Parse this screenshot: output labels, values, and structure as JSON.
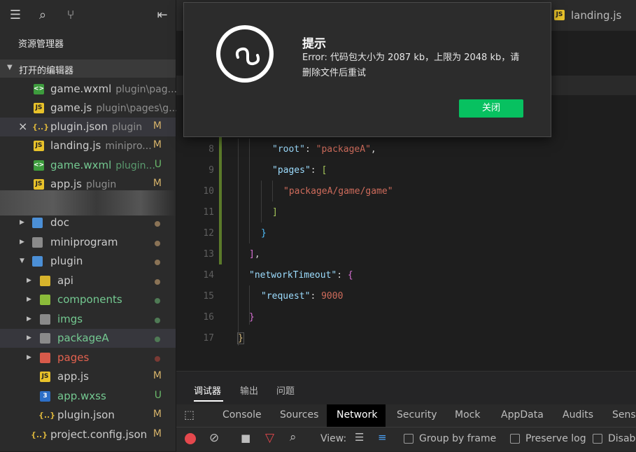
{
  "sidebar": {
    "explorer_title": "资源管理器",
    "open_editors_title": "打开的编辑器",
    "open_editors": [
      {
        "icon": "<>",
        "name": "game.wxml",
        "path": "plugin\\pag...",
        "status": ""
      },
      {
        "icon": "JS",
        "name": "game.js",
        "path": "plugin\\pages\\g...",
        "status": ""
      },
      {
        "icon": "{..}",
        "name": "plugin.json",
        "path": "plugin",
        "status": "M"
      },
      {
        "icon": "JS",
        "name": "landing.js",
        "path": "minipro...",
        "status": "M"
      },
      {
        "icon": "<>",
        "name": "game.wxml",
        "path": "plugin...",
        "status": "U"
      },
      {
        "icon": "JS",
        "name": "app.js",
        "path": "plugin",
        "status": "M"
      }
    ],
    "tree": [
      {
        "name": "doc",
        "status": ""
      },
      {
        "name": "miniprogram",
        "status": ""
      },
      {
        "name": "plugin",
        "status": ""
      },
      {
        "name": "api",
        "status": ""
      },
      {
        "name": "components",
        "status": ""
      },
      {
        "name": "imgs",
        "status": ""
      },
      {
        "name": "packageA",
        "status": ""
      },
      {
        "name": "pages",
        "status": ""
      },
      {
        "name": "app.js",
        "status": "M"
      },
      {
        "name": "app.wxss",
        "status": "U"
      },
      {
        "name": "plugin.json",
        "status": "M"
      },
      {
        "name": "project.config.json",
        "status": "M"
      }
    ]
  },
  "editor": {
    "tab_landing": "landing.js",
    "tab_landing_icon": "JS",
    "line_numbers": [
      "8",
      "9",
      "10",
      "11",
      "12",
      "13",
      "14",
      "15",
      "16",
      "17"
    ],
    "code": {
      "l8_key": "\"root\"",
      "l8_colon": ": ",
      "l8_val": "\"packageA\"",
      "l8_comma": ",",
      "l9_key": "\"pages\"",
      "l9_colon": ": ",
      "l9_br": "[",
      "l10_val": "\"packageA/game/game\"",
      "l11": "]",
      "l12": "}",
      "l13": "]",
      "l13_comma": ",",
      "l14_key": "\"networkTimeout\"",
      "l14_colon": ": ",
      "l14_br": "{",
      "l15_key": "\"request\"",
      "l15_colon": ": ",
      "l15_val": "9000",
      "l16": "}",
      "l17": "}"
    }
  },
  "panel": {
    "tabs": [
      "调试器",
      "输出",
      "问题"
    ],
    "devtools_tabs": [
      "Console",
      "Sources",
      "Network",
      "Security",
      "Mock",
      "AppData",
      "Audits",
      "Senso"
    ],
    "toolbar": {
      "view_label": "View:",
      "group_by_frame": "Group by frame",
      "preserve_log": "Preserve log",
      "disable_cache": "Disabl"
    }
  },
  "modal": {
    "title": "提示",
    "message": "Error: 代码包大小为 2087 kb，上限为 2048 kb，请删除文件后重试",
    "close_button": "关闭"
  },
  "colors": {
    "accent_green": "#07c160",
    "status_modified": "#d6b36a",
    "status_untracked": "#6ab86a"
  }
}
